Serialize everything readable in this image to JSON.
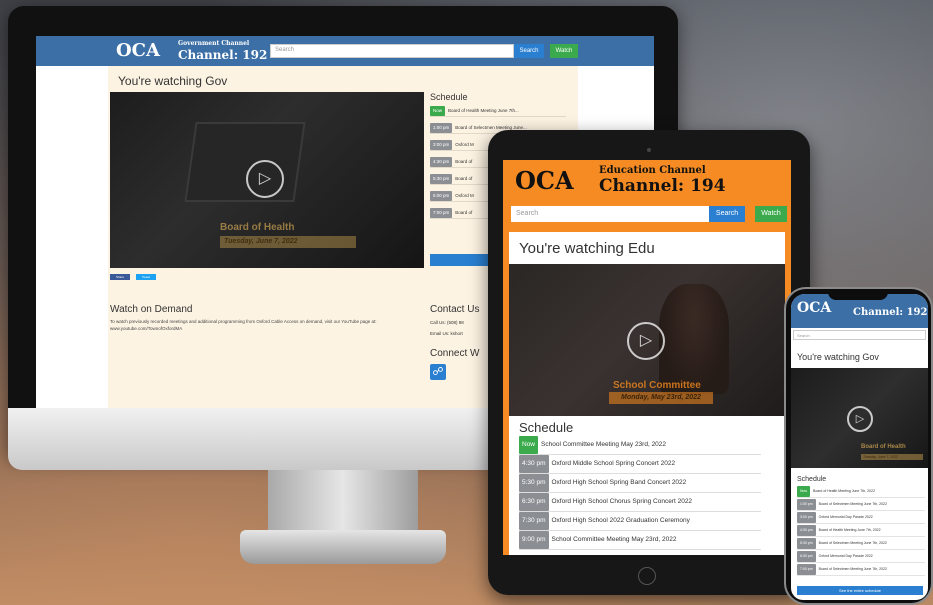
{
  "desktop": {
    "logo": "OCA",
    "channel_sub": "Government Channel",
    "channel_num": "Channel: 192",
    "search_placeholder": "Search",
    "search_btn": "Search",
    "watch_btn": "Watch",
    "title": "You're watching Gov",
    "video_overlay_title": "Board of Health",
    "video_overlay_date": "Tuesday, June 7, 2022",
    "share_fb": "Share",
    "share_tw": "Tweet",
    "schedule_title": "Schedule",
    "schedule": [
      {
        "badge": "Now",
        "kind": "now",
        "text": "Board of Health Meeting June 7th..."
      },
      {
        "badge": "1:00 pm",
        "kind": "time",
        "text": "Board of Selectmen Meeting June..."
      },
      {
        "badge": "3:00 pm",
        "kind": "time",
        "text": "Oxford M"
      },
      {
        "badge": "4:30 pm",
        "kind": "time",
        "text": "Board of"
      },
      {
        "badge": "5:30 pm",
        "kind": "time",
        "text": "Board of"
      },
      {
        "badge": "6:00 pm",
        "kind": "time",
        "text": "Oxford M"
      },
      {
        "badge": "7:00 pm",
        "kind": "time",
        "text": "Board of"
      }
    ],
    "schedule_btn": "See the",
    "demand_title": "Watch on Demand",
    "demand_text": "To watch previously recorded meetings and additional programming from Oxford Cable Access on demand, visit our YouTube page at: www.youtube.com/TownofOxfordMA",
    "contact_title": "Contact Us",
    "contact_call": "Call Us: (508) 98",
    "contact_email": "Email Us: kshort",
    "connect_title": "Connect W",
    "web_icon": "web-icon"
  },
  "tablet": {
    "logo": "OCA",
    "channel_sub": "Education Channel",
    "channel_num": "Channel: 194",
    "search_placeholder": "Search",
    "search_btn": "Search",
    "watch_btn": "Watch",
    "title": "You're watching Edu",
    "video_overlay_title": "School Committee",
    "video_overlay_date": "Monday, May 23rd, 2022",
    "schedule_title": "Schedule",
    "schedule": [
      {
        "badge": "Now",
        "kind": "now",
        "text": "School Committee Meeting May 23rd, 2022"
      },
      {
        "badge": "4:30 pm",
        "kind": "time",
        "text": "Oxford Middle School Spring Concert 2022"
      },
      {
        "badge": "5:30 pm",
        "kind": "time",
        "text": "Oxford High School Spring Band Concert 2022"
      },
      {
        "badge": "6:30 pm",
        "kind": "time",
        "text": "Oxford High School Chorus Spring Concert 2022"
      },
      {
        "badge": "7:30 pm",
        "kind": "time",
        "text": "Oxford High School 2022 Graduation Ceremony"
      },
      {
        "badge": "9:00 pm",
        "kind": "time",
        "text": "School Committee Meeting May 23rd, 2022"
      }
    ]
  },
  "phone": {
    "logo": "OCA",
    "channel_num": "Channel: 192",
    "search_placeholder": "Search",
    "title": "You're watching Gov",
    "video_overlay_title": "Board of Health",
    "video_overlay_date": "Tuesday, June 7, 2022",
    "schedule_title": "Schedule",
    "schedule": [
      {
        "badge": "Now",
        "kind": "now",
        "text": "Board of Health Meeting June 7th, 2022"
      },
      {
        "badge": "1:00 pm",
        "kind": "time",
        "text": "Board of Selectmen Meeting June 7th, 2022"
      },
      {
        "badge": "3:00 pm",
        "kind": "time",
        "text": "Oxford Memorial Day Parade 2022"
      },
      {
        "badge": "4:30 pm",
        "kind": "time",
        "text": "Board of Health Meeting June 7th, 2022"
      },
      {
        "badge": "5:30 pm",
        "kind": "time",
        "text": "Board of Selectmen Meeting June 7th, 2022"
      },
      {
        "badge": "6:30 pm",
        "kind": "time",
        "text": "Oxford Memorial Day Parade 2022"
      },
      {
        "badge": "7:00 pm",
        "kind": "time",
        "text": "Board of Selectmen Meeting June 7th, 2022"
      }
    ],
    "schedule_btn": "See the entire schedule"
  },
  "colors": {
    "gov_header": "#3b6fa6",
    "edu_header": "#f58b22",
    "primary_btn": "#2a7fd1",
    "watch_btn": "#3aaa4d",
    "badge_now": "#3aaa4d",
    "badge_time": "#8b8f94"
  }
}
